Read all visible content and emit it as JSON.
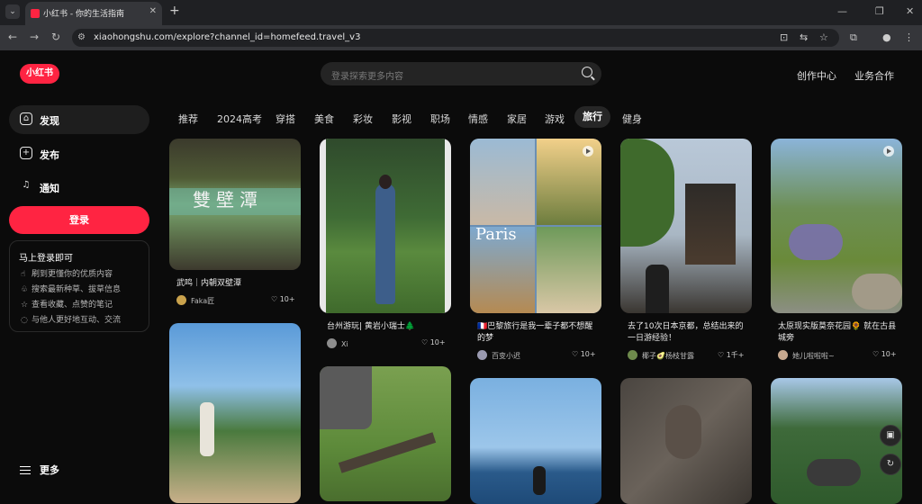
{
  "browser": {
    "tab_title": "小红书 - 你的生活指南",
    "tab_close": "✕",
    "new_tab": "+",
    "url": "xiaohongshu.com/explore?channel_id=homefeed.travel_v3",
    "nav_back": "←",
    "nav_forward": "→",
    "nav_reload": "↻",
    "win_min": "—",
    "win_max": "❐",
    "win_close": "✕"
  },
  "header": {
    "logo": "小红书",
    "search_placeholder": "登录探索更多内容",
    "links": [
      "创作中心",
      "业务合作"
    ]
  },
  "sidebar": {
    "items": [
      {
        "label": "发现",
        "icon": "home-icon",
        "glyph": "⌂"
      },
      {
        "label": "发布",
        "icon": "plus-icon",
        "glyph": "+"
      },
      {
        "label": "通知",
        "icon": "bell-icon",
        "glyph": "♫"
      }
    ],
    "login_button": "登录",
    "promo": {
      "title": "马上登录即可",
      "lines": [
        "刷到更懂你的优质内容",
        "搜索最新种草、拔草信息",
        "查看收藏、点赞的笔记",
        "与他人更好地互动、交流"
      ]
    },
    "more": "更多"
  },
  "channels": [
    "推荐",
    "2024高考",
    "穿搭",
    "美食",
    "彩妆",
    "影视",
    "职场",
    "情感",
    "家居",
    "游戏",
    "旅行",
    "健身"
  ],
  "active_channel": "旅行",
  "cards": [
    {
      "title": "武鸣｜内朝双壁潭",
      "user": "Faka匠",
      "likes": "10+",
      "overlay_text": "雙壁潭"
    },
    {
      "title": "台州游玩| 黄岩小瑞士🌲",
      "user": "Xi",
      "likes": "10+"
    },
    {
      "title": "🇫🇷巴黎旅行是我一辈子都不想醒的梦",
      "user": "百变小迟",
      "likes": "10+",
      "overlay_text": "Paris"
    },
    {
      "title": "去了10次日本京都，总结出来的一日游经验！",
      "user": "椰子🥑杨枝甘露",
      "likes": "1千+"
    },
    {
      "title": "太原现实版莫奈花园🌻 就在古县城旁",
      "user": "她儿啦啦啦~",
      "likes": "10+"
    }
  ],
  "colors": {
    "brand": "#ff2442",
    "background": "#0b0b0b"
  }
}
